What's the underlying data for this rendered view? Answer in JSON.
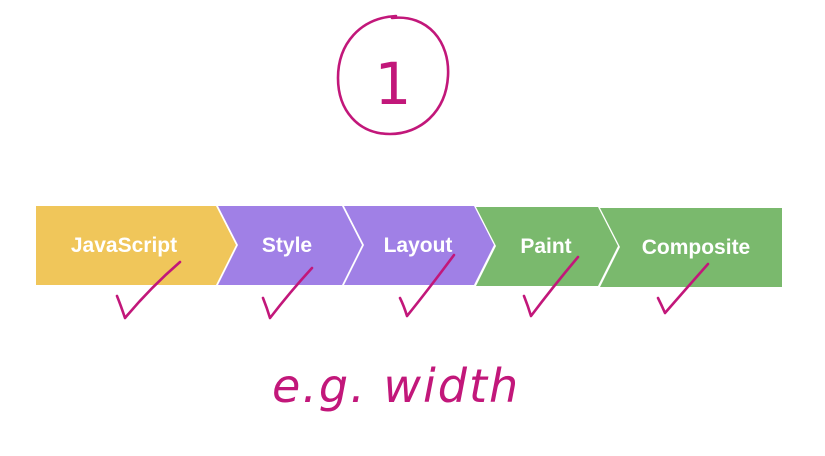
{
  "circled_number": "1",
  "handwritten_note": "e.g. width",
  "pipeline": {
    "stages": [
      {
        "label": "JavaScript",
        "color": "#f0c65a",
        "checked": true
      },
      {
        "label": "Style",
        "color": "#a080e6",
        "checked": true
      },
      {
        "label": "Layout",
        "color": "#a080e6",
        "checked": true
      },
      {
        "label": "Paint",
        "color": "#7ab96d",
        "checked": true
      },
      {
        "label": "Composite",
        "color": "#7ab96d",
        "checked": true
      }
    ]
  },
  "ink_color": "#c2177a"
}
